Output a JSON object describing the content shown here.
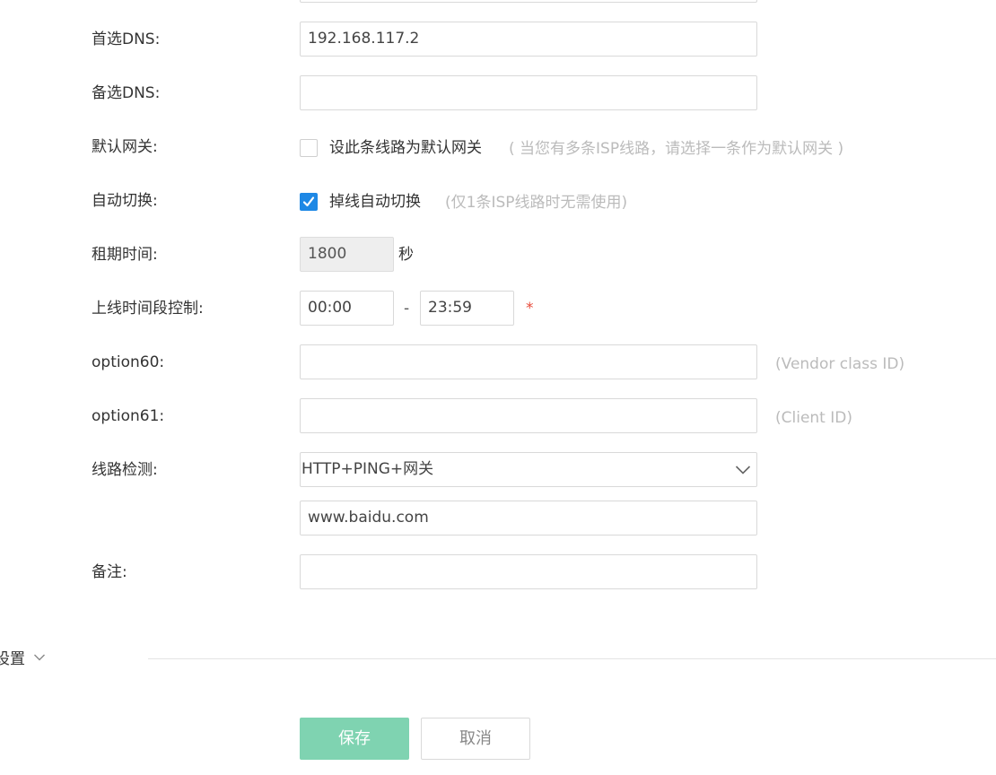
{
  "form": {
    "primary_dns": {
      "label": "首选DNS:",
      "value": "192.168.117.2"
    },
    "secondary_dns": {
      "label": "备选DNS:",
      "value": ""
    },
    "default_gateway": {
      "label": "默认网关:",
      "checkbox_label": "设此条线路为默认网关",
      "checked": false,
      "hint": "( 当您有多条ISP线路，请选择一条作为默认网关 )"
    },
    "auto_switch": {
      "label": "自动切换:",
      "checkbox_label": "掉线自动切换",
      "checked": true,
      "hint": "(仅1条ISP线路时无需使用)"
    },
    "lease_time": {
      "label": "租期时间:",
      "value": "1800",
      "unit": "秒"
    },
    "online_time": {
      "label": "上线时间段控制:",
      "start": "00:00",
      "separator": "-",
      "end": "23:59",
      "required_mark": "*"
    },
    "option60": {
      "label": "option60:",
      "value": "",
      "hint": "(Vendor class ID)"
    },
    "option61": {
      "label": "option61:",
      "value": "",
      "hint": "(Client ID)"
    },
    "line_check": {
      "label": "线路检测:",
      "selected": "HTTP+PING+网关",
      "target": "www.baidu.com"
    },
    "remark": {
      "label": "备注:",
      "value": ""
    }
  },
  "advanced_section": {
    "label": "设置"
  },
  "actions": {
    "save_label": "保存",
    "cancel_label": "取消"
  },
  "colors": {
    "accent": "#1e88e5",
    "save_button": "#7fd3b1",
    "required": "#e74c3c",
    "hint": "#bbbbbb"
  },
  "icons": {
    "checkmark": "checkmark-icon",
    "select_arrow": "chevron-down-icon",
    "section_arrow": "chevron-down-icon"
  }
}
